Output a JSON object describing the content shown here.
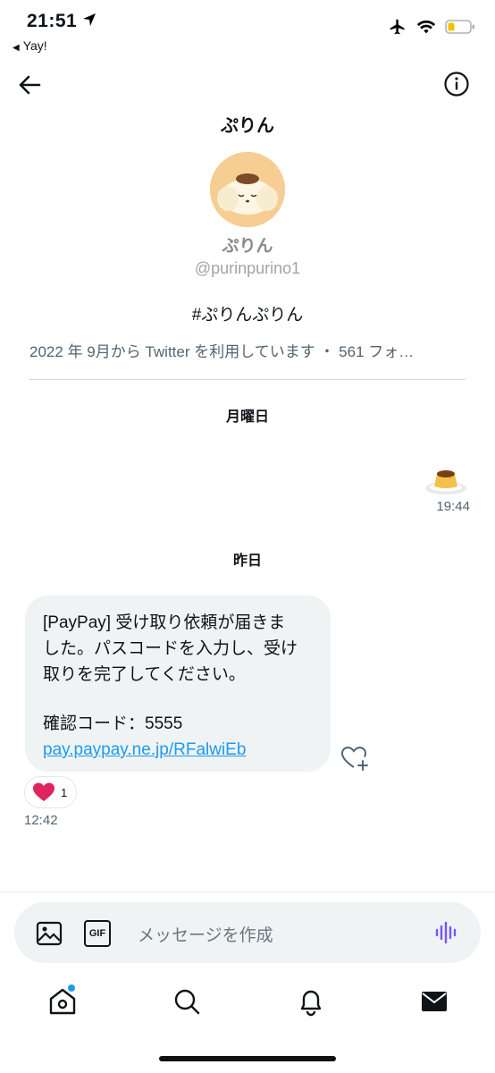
{
  "status_bar": {
    "time": "21:51",
    "back_app": "Yay!"
  },
  "header": {
    "title": "ぷりん"
  },
  "profile": {
    "name": "ぷりん",
    "handle": "@purinpurino1",
    "bio": "#ぷりんぷりん",
    "meta": "2022 年 9月から Twitter を利用しています ・ 561 フォ…"
  },
  "messages": {
    "day1_label": "月曜日",
    "sent_time": "19:44",
    "day2_label": "昨日",
    "received": {
      "line1": "[PayPay] 受け取り依頼が届きま",
      "line2": "した。パスコードを入力し、受け",
      "line3": "取りを完了してください。",
      "line4": "確認コード：5555",
      "link": "pay.paypay.ne.jp/RFalwiEb",
      "reaction_count": "1",
      "time": "12:42"
    }
  },
  "composer": {
    "placeholder": "メッセージを作成",
    "gif_label": "GIF"
  },
  "colors": {
    "accent": "#1d9bf0",
    "voice": "#7856ff",
    "heart": "#e0245e"
  },
  "icons": [
    "back-arrow-icon",
    "info-icon",
    "image-icon",
    "gif-icon",
    "voice-icon",
    "home-icon",
    "search-icon",
    "bell-icon",
    "mail-icon"
  ]
}
